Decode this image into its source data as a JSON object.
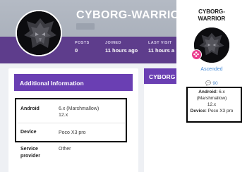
{
  "profile": {
    "username": "CYBORG-WARRIOR",
    "stats": [
      {
        "label": "POSTS",
        "value": "0"
      },
      {
        "label": "JOINED",
        "value": "11 hours ago"
      },
      {
        "label": "LAST VISIT",
        "value": "11 hours a"
      }
    ]
  },
  "info_card": {
    "title": "Additional Information",
    "rows": [
      {
        "label": "Android",
        "value_line1": "6.x (Marshmallow)",
        "value_line2": "12.x"
      },
      {
        "label": "Device",
        "value_line1": "Poco X3 pro"
      },
      {
        "label_line1": "Service",
        "label_line2": "provider",
        "value_line1": "Other"
      }
    ]
  },
  "side_card": {
    "title": "CYBORG"
  },
  "popup": {
    "name_line1": "CYBORG-",
    "name_line2": "WARRIOR",
    "rank": "Ascended",
    "reputation": "90",
    "android_label": "Android:",
    "android_value": "6.x",
    "android_value2": "(Marshmallow)",
    "android_value3": "12.x",
    "device_label": "Device:",
    "device_value": "Poco X3 pro"
  },
  "colors": {
    "accent": "#6a3fb3",
    "banner": "#5e3d8c",
    "link": "#3f87d6",
    "badge": "#ea3a8c"
  }
}
